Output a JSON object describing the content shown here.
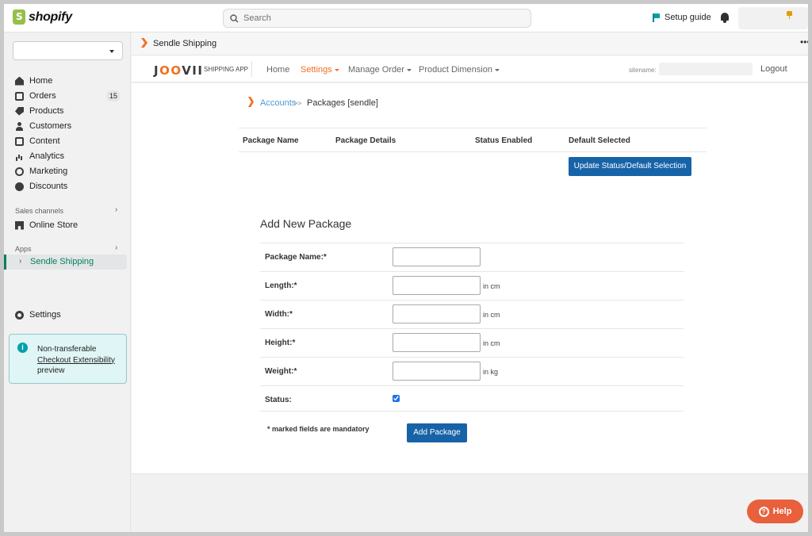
{
  "topbar": {
    "logo_text": "shopify",
    "search_placeholder": "Search",
    "setup_guide": "Setup guide"
  },
  "sidebar": {
    "items": [
      {
        "label": "Home",
        "icon": "home-icon"
      },
      {
        "label": "Orders",
        "icon": "orders-icon",
        "badge": "15"
      },
      {
        "label": "Products",
        "icon": "tag-icon"
      },
      {
        "label": "Customers",
        "icon": "person-icon"
      },
      {
        "label": "Content",
        "icon": "content-icon"
      },
      {
        "label": "Analytics",
        "icon": "analytics-icon"
      },
      {
        "label": "Marketing",
        "icon": "marketing-icon"
      },
      {
        "label": "Discounts",
        "icon": "discount-icon"
      }
    ],
    "sales_channels_title": "Sales channels",
    "online_store": "Online Store",
    "apps_title": "Apps",
    "active_app": "Sendle Shipping",
    "settings": "Settings",
    "banner": {
      "line1": "Non-transferable",
      "link": "Checkout Extensibility",
      "line3": "preview"
    }
  },
  "app_header": {
    "title": "Sendle Shipping"
  },
  "joovii_nav": {
    "brand_prefix": "J",
    "brand_oo": "OO",
    "brand_suffix": "VII",
    "brand_sub": "SHIPPING APP",
    "items": [
      {
        "label": "Home"
      },
      {
        "label": "Settings"
      },
      {
        "label": "Manage Order"
      },
      {
        "label": "Product Dimension"
      }
    ],
    "sitename_label": "sitename:",
    "logout": "Logout"
  },
  "breadcrumb": {
    "link": "Accounts",
    "separator": ">>",
    "current": "Packages [sendle]"
  },
  "packages_table": {
    "headers": [
      "Package Name",
      "Package Details",
      "Status Enabled",
      "Default Selected"
    ],
    "update_button": "Update Status/Default Selection"
  },
  "add_package": {
    "title": "Add New Package",
    "fields": [
      {
        "label": "Package Name:*",
        "value": "",
        "unit": ""
      },
      {
        "label": "Length:*",
        "value": "",
        "unit": "in cm"
      },
      {
        "label": "Width:*",
        "value": "",
        "unit": "in cm"
      },
      {
        "label": "Height:*",
        "value": "",
        "unit": "in cm"
      },
      {
        "label": "Weight:*",
        "value": "",
        "unit": "in kg"
      }
    ],
    "status_label": "Status:",
    "status_checked": true,
    "mandatory_note": "* marked fields are mandatory",
    "add_button": "Add Package"
  },
  "help": {
    "label": "Help"
  },
  "colors": {
    "accent_orange": "#f26f21",
    "button_blue": "#1763a8",
    "link_blue": "#4a9bd6",
    "shopify_green": "#008060",
    "help_orange": "#e8603c"
  }
}
